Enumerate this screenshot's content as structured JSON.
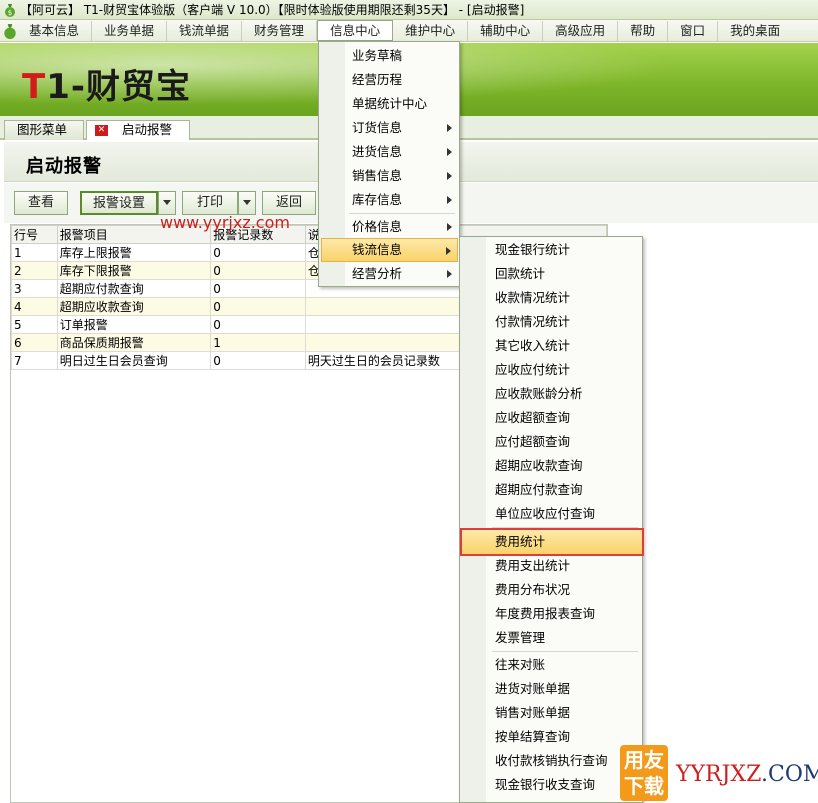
{
  "window": {
    "title": "【阿可云】 T1-财贸宝体验版（客户端 V 10.0）【限时体验版使用期限还剩35天】 - [启动报警]"
  },
  "menubar": {
    "items": [
      "基本信息",
      "业务单据",
      "钱流单据",
      "财务管理",
      "信息中心",
      "维护中心",
      "辅助中心",
      "高级应用",
      "帮助",
      "窗口",
      "我的桌面"
    ]
  },
  "banner": {
    "logo_t": "T",
    "logo_rest": "1-财贸宝"
  },
  "tabs": [
    {
      "label": "图形菜单"
    },
    {
      "label": "启动报警",
      "close": "✕"
    }
  ],
  "page": {
    "title": "启动报警"
  },
  "toolbar": {
    "view": "查看",
    "alarm_settings": "报警设置",
    "print": "打印",
    "back": "返回"
  },
  "watermark": "www.yyrjxz.com",
  "grid": {
    "headers": [
      "行号",
      "报警项目",
      "报警记录数",
      "说"
    ],
    "rows": [
      [
        "1",
        "库存上限报警",
        "0",
        "仓"
      ],
      [
        "2",
        "库存下限报警",
        "0",
        "仓"
      ],
      [
        "3",
        "超期应付款查询",
        "0",
        ""
      ],
      [
        "4",
        "超期应收款查询",
        "0",
        ""
      ],
      [
        "5",
        "订单报警",
        "0",
        ""
      ],
      [
        "6",
        "商品保质期报警",
        "1",
        ""
      ],
      [
        "7",
        "明日过生日会员查询",
        "0",
        "明天过生日的会员记录数"
      ]
    ]
  },
  "info_menu": {
    "items": [
      {
        "label": "业务草稿",
        "arrow": false
      },
      {
        "label": "经营历程",
        "arrow": false
      },
      {
        "label": "单据统计中心",
        "arrow": false
      },
      {
        "label": "订货信息",
        "arrow": true
      },
      {
        "label": "进货信息",
        "arrow": true
      },
      {
        "label": "销售信息",
        "arrow": true
      },
      {
        "label": "库存信息",
        "arrow": true
      },
      {
        "label": "价格信息",
        "arrow": true
      },
      {
        "label": "钱流信息",
        "arrow": true
      },
      {
        "label": "经营分析",
        "arrow": true
      }
    ]
  },
  "cashflow_menu": {
    "items": [
      "现金银行统计",
      "回款统计",
      "收款情况统计",
      "付款情况统计",
      "其它收入统计",
      "应收应付统计",
      "应收款账龄分析",
      "应收超额查询",
      "应付超额查询",
      "超期应收款查询",
      "超期应付款查询",
      "单位应收应付查询",
      "费用统计",
      "费用支出统计",
      "费用分布状况",
      "年度费用报表查询",
      "发票管理",
      "往来对账",
      "进货对账单据",
      "销售对账单据",
      "按单结算查询",
      "收付款核销执行查询",
      "现金银行收支查询"
    ]
  },
  "corner": {
    "line1": "用友",
    "line2": "下载",
    "brand_red": "YYRJXZ",
    "brand_dark": ".COM"
  },
  "colors": {
    "banner_green": "#7fb72a",
    "highlight": "#f9d36a",
    "highlight_border": "#e03c3c",
    "logo_red": "#d21c1c"
  }
}
